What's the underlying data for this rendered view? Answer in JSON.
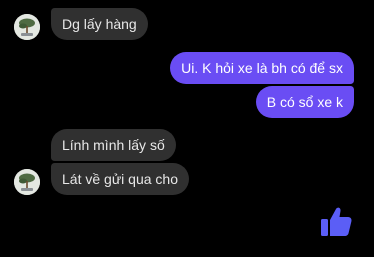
{
  "conversation": {
    "messages": [
      {
        "direction": "incoming",
        "text": "Dg lấy hàng"
      },
      {
        "direction": "outgoing",
        "text": "Ui. K hỏi xe là bh có để sx"
      },
      {
        "direction": "outgoing",
        "text": "B có sổ xe k"
      },
      {
        "direction": "incoming",
        "text": "Lính mình lấy số"
      },
      {
        "direction": "incoming",
        "text": "Lát về gửi qua cho"
      }
    ],
    "reaction_icon": "thumbs-up-icon"
  },
  "colors": {
    "background": "#000000",
    "incoming_bubble": "#303030",
    "outgoing_bubble": "#6a4df4",
    "like_icon": "#5b5ef6"
  }
}
